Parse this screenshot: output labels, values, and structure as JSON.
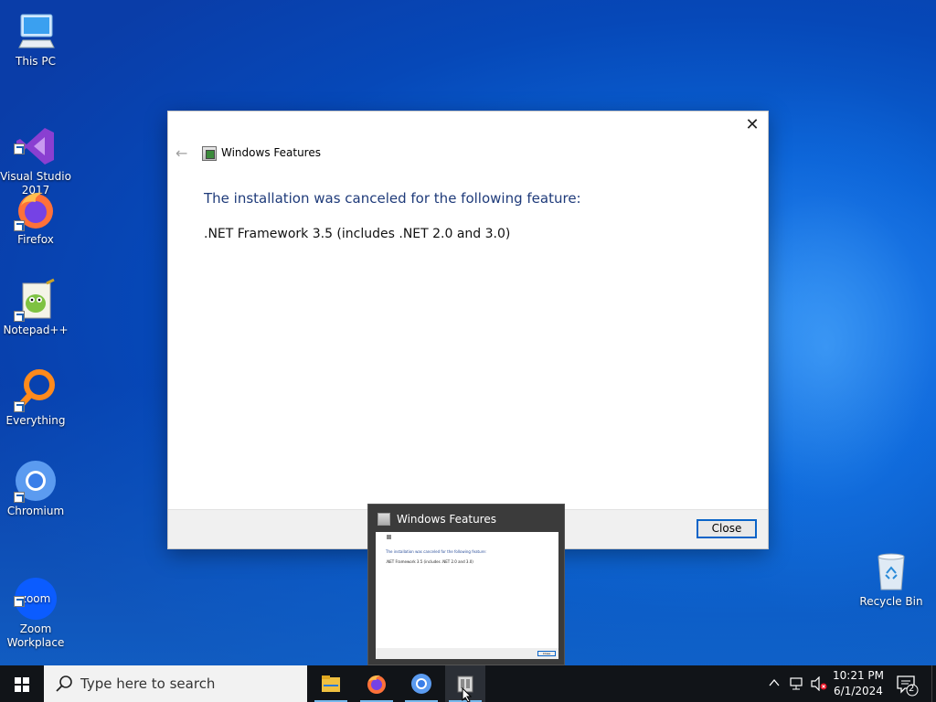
{
  "desktop": {
    "icons": [
      {
        "label": "This PC",
        "icon": "computer-icon"
      },
      {
        "label": "Visual Studio\n2017",
        "icon": "visual-studio-icon"
      },
      {
        "label": "Firefox",
        "icon": "firefox-icon"
      },
      {
        "label": "Notepad++",
        "icon": "notepadpp-icon"
      },
      {
        "label": "Everything",
        "icon": "everything-search-icon"
      },
      {
        "label": "Chromium",
        "icon": "chromium-icon"
      },
      {
        "label": "Zoom\nWorkplace",
        "icon": "zoom-icon"
      },
      {
        "label": "Recycle Bin",
        "icon": "recycle-bin-icon"
      }
    ]
  },
  "dialog": {
    "title": "Windows Features",
    "heading": "The installation was canceled for the following feature:",
    "feature": ".NET Framework 3.5 (includes .NET 2.0 and 3.0)",
    "close_button": "Close",
    "close_glyph": "✕",
    "back_glyph": "←"
  },
  "preview": {
    "title": "Windows Features",
    "thumb_heading": "The installation was canceled for the following feature:",
    "thumb_feature": ".NET Framework 3.5 (includes .NET 2.0 and 3.0)",
    "thumb_button": "Close"
  },
  "taskbar": {
    "search_placeholder": "Type here to search",
    "apps": [
      "file-explorer-icon",
      "firefox-icon",
      "chromium-icon",
      "windows-features-icon"
    ],
    "time": "10:21 PM",
    "date": "6/1/2024",
    "notification_count": "2",
    "accent": "#76b9ed"
  }
}
